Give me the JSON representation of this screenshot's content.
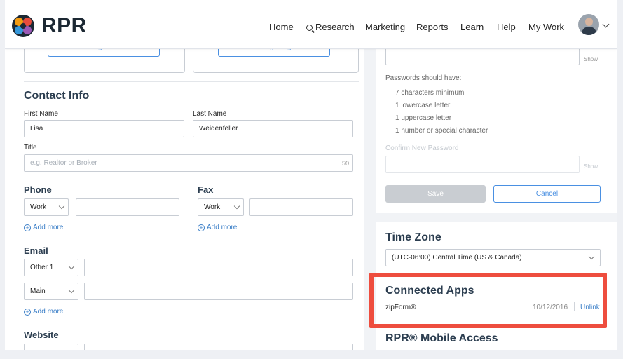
{
  "header": {
    "brand": "RPR",
    "nav": {
      "home": "Home",
      "research": "Research",
      "marketing": "Marketing",
      "reports": "Reports",
      "learn": "Learn",
      "help": "Help",
      "my_work": "My Work"
    }
  },
  "photos": {
    "change_photo": "Change Photo",
    "change_logo": "Change Logo"
  },
  "contact": {
    "heading": "Contact Info",
    "first_name_label": "First Name",
    "first_name_value": "Lisa",
    "last_name_label": "Last Name",
    "last_name_value": "Weidenfeller",
    "title_label": "Title",
    "title_placeholder": "e.g. Realtor or Broker",
    "title_counter": "50"
  },
  "phone": {
    "heading": "Phone",
    "type": "Work",
    "add_more": "Add more"
  },
  "fax": {
    "heading": "Fax",
    "type": "Work",
    "add_more": "Add more"
  },
  "email": {
    "heading": "Email",
    "rows": [
      {
        "type": "Other 1"
      },
      {
        "type": "Main"
      }
    ],
    "add_more": "Add more"
  },
  "website": {
    "heading": "Website"
  },
  "password": {
    "show": "Show",
    "requirements_title": "Passwords should have:",
    "rules": [
      "7 characters minimum",
      "1 lowercase letter",
      "1 uppercase letter",
      "1 number or special character"
    ],
    "confirm_label": "Confirm New Password",
    "save": "Save",
    "cancel": "Cancel"
  },
  "timezone": {
    "heading": "Time Zone",
    "selected": "(UTC-06:00) Central Time (US & Canada)"
  },
  "connected_apps": {
    "heading": "Connected Apps",
    "apps": [
      {
        "name": "zipForm®",
        "date": "10/12/2016",
        "action": "Unlink"
      }
    ]
  },
  "mobile": {
    "heading": "RPR® Mobile Access"
  },
  "colors": {
    "accent": "#4a90e2",
    "highlight": "#ee4d3e",
    "heading": "#2c3e50"
  }
}
